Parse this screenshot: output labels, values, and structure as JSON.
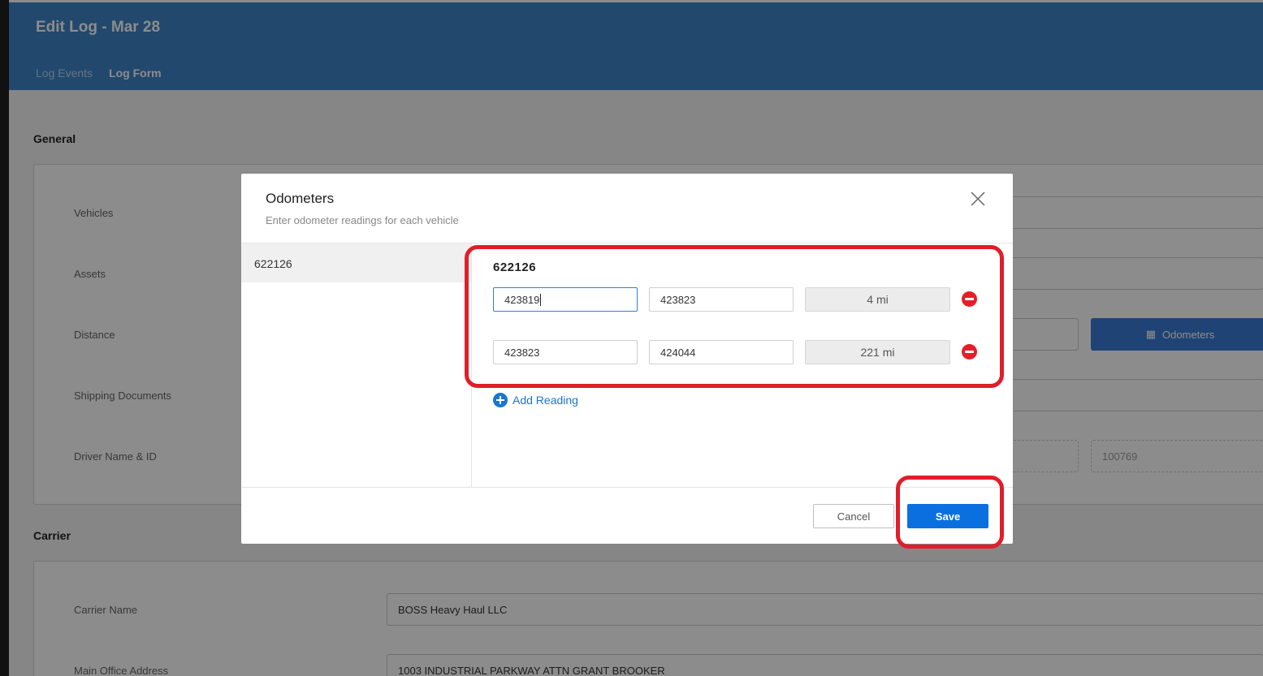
{
  "page": {
    "title": "Edit Log - Mar 28",
    "tabs": [
      {
        "label": "Log Events",
        "active": false
      },
      {
        "label": "Log Form",
        "active": true
      }
    ]
  },
  "general": {
    "section_title": "General",
    "labels": {
      "vehicles": "Vehicles",
      "assets": "Assets",
      "distance": "Distance",
      "shipping_documents": "Shipping Documents",
      "driver_name_id": "Driver Name & ID"
    },
    "odometers_button": "Odometers",
    "driver_id_placeholder": "100769"
  },
  "carrier": {
    "section_title": "Carrier",
    "labels": {
      "carrier_name": "Carrier Name",
      "main_office_address": "Main Office Address"
    },
    "carrier_name_value": "BOSS Heavy Haul LLC",
    "main_office_address_value": "1003 INDUSTRIAL PARKWAY ATTN GRANT BROOKER"
  },
  "modal": {
    "title": "Odometers",
    "subtitle": "Enter odometer readings for each vehicle",
    "vehicles": [
      "622126"
    ],
    "selected_vehicle": "622126",
    "readings": [
      {
        "start": "423819",
        "end": "423823",
        "distance": "4 mi"
      },
      {
        "start": "423823",
        "end": "424044",
        "distance": "221 mi"
      }
    ],
    "add_reading_label": "Add Reading",
    "cancel_label": "Cancel",
    "save_label": "Save"
  },
  "colors": {
    "header": "#3f83c7",
    "primary": "#0a70e0",
    "danger": "#e3202a",
    "highlight": "#e01e2a"
  }
}
